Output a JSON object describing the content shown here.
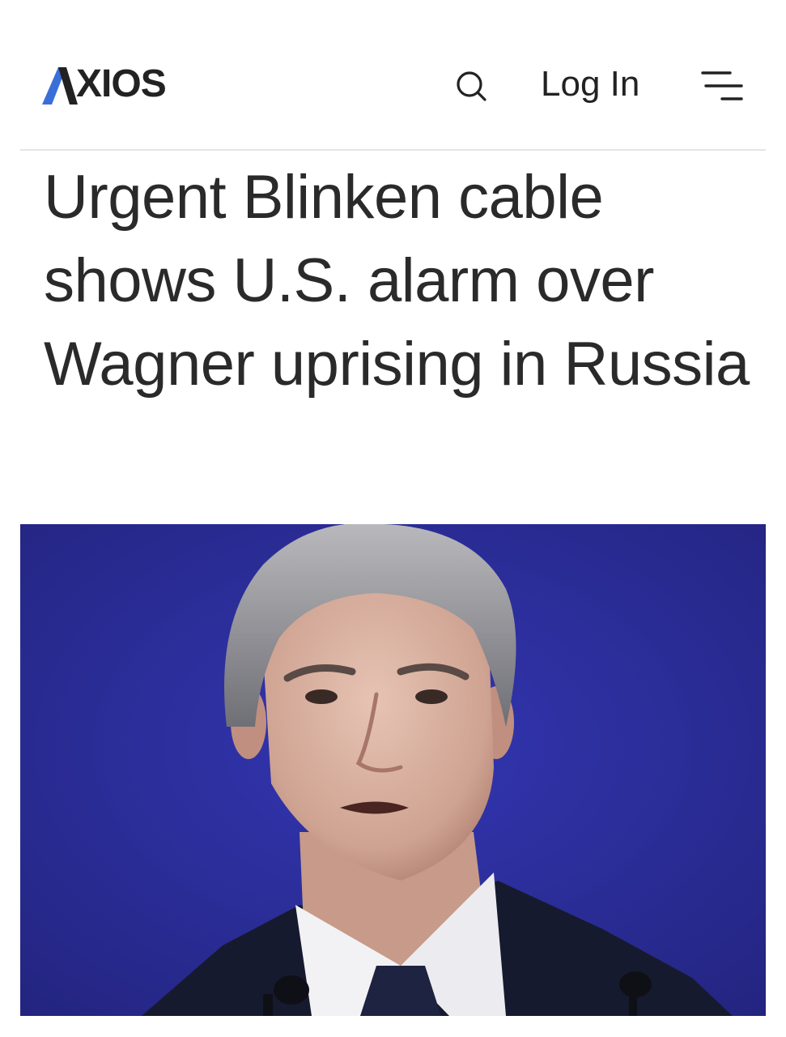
{
  "header": {
    "logo_text": "XIOS",
    "logo_alt": "AXIOS",
    "search_icon": "search-icon",
    "login_label": "Log In",
    "menu_icon": "hamburger-menu-icon"
  },
  "article": {
    "headline": "Urgent Blinken cable shows U.S. alarm over Wagner uprising in Russia"
  },
  "hero_image": {
    "alt": "Man in dark suit and tie speaking in front of a blue background"
  },
  "colors": {
    "logo_accent": "#3b6fd8",
    "text": "#222222",
    "photo_background": "#2b2c9a",
    "divider": "#e5e5e5"
  }
}
